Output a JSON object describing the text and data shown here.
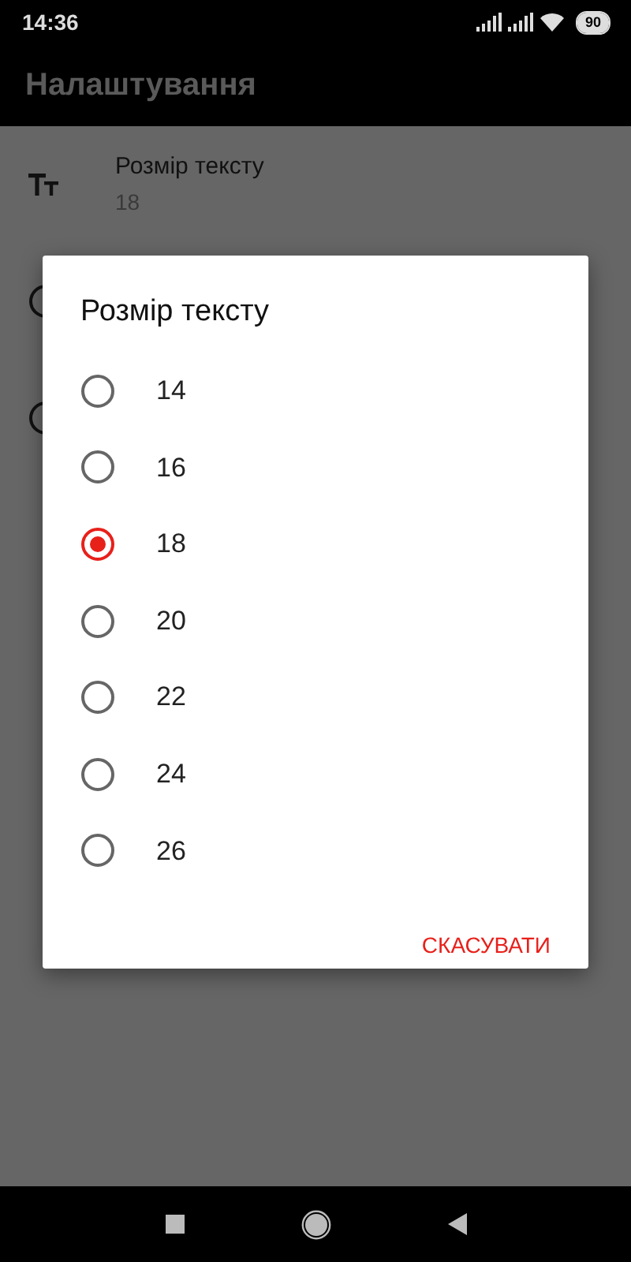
{
  "status_bar": {
    "time": "14:36",
    "battery": "90"
  },
  "app_bar": {
    "title": "Налаштування"
  },
  "settings": [
    {
      "kind": "text_size",
      "title": "Розмір тексту",
      "value": "18"
    },
    {
      "kind": "radio"
    },
    {
      "kind": "radio"
    }
  ],
  "dialog": {
    "title": "Розмір тексту",
    "options": [
      {
        "label": "14",
        "selected": false
      },
      {
        "label": "16",
        "selected": false
      },
      {
        "label": "18",
        "selected": true
      },
      {
        "label": "20",
        "selected": false
      },
      {
        "label": "22",
        "selected": false
      },
      {
        "label": "24",
        "selected": false
      },
      {
        "label": "26",
        "selected": false
      }
    ],
    "buttons": [
      "СКАСУВАТИ"
    ]
  }
}
